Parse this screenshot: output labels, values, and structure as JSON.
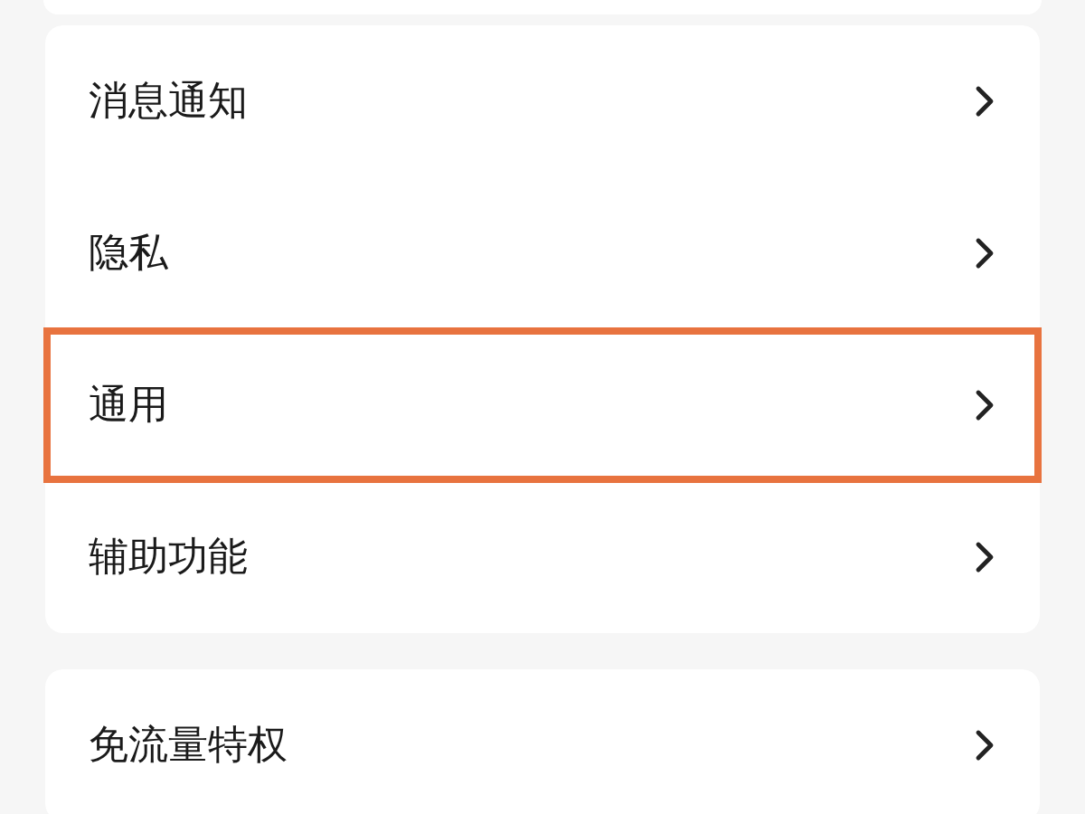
{
  "groups": [
    {
      "items": [
        {
          "label": "消息通知",
          "highlighted": false
        },
        {
          "label": "隐私",
          "highlighted": false
        },
        {
          "label": "通用",
          "highlighted": true
        },
        {
          "label": "辅助功能",
          "highlighted": false
        }
      ]
    },
    {
      "items": [
        {
          "label": "免流量特权",
          "highlighted": false
        }
      ]
    }
  ]
}
